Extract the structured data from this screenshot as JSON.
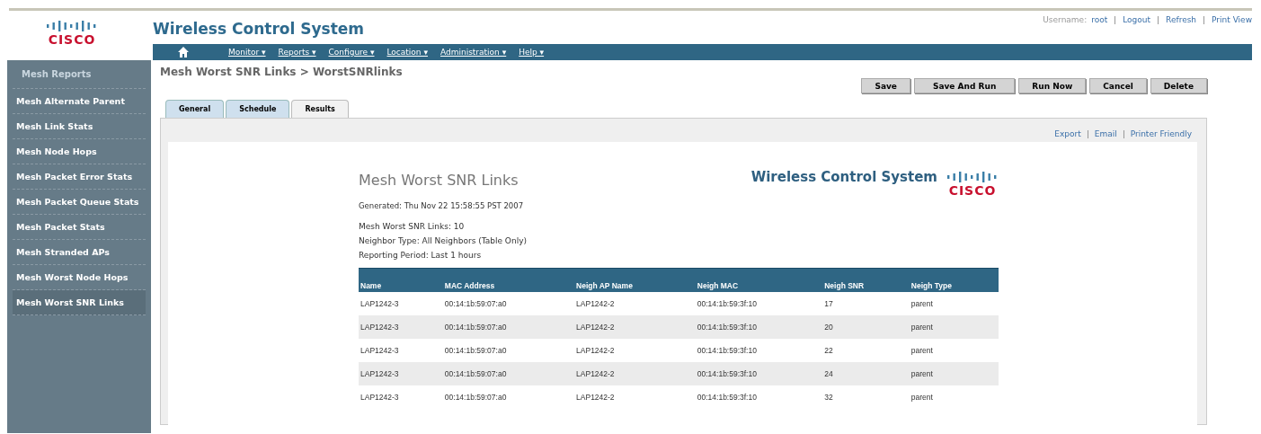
{
  "header": {
    "logo_text": "CISCO",
    "title": "Wireless Control System",
    "user_label": "Username:",
    "user": "root",
    "links": [
      "Logout",
      "Refresh",
      "Print View"
    ]
  },
  "nav": [
    "Monitor ▾",
    "Reports ▾",
    "Configure ▾",
    "Location ▾",
    "Administration ▾",
    "Help ▾"
  ],
  "sidebar": {
    "title": "Mesh Reports",
    "items": [
      {
        "label": "Mesh Alternate Parent",
        "selected": false
      },
      {
        "label": "Mesh Link Stats",
        "selected": false
      },
      {
        "label": "Mesh Node Hops",
        "selected": false
      },
      {
        "label": "Mesh Packet Error Stats",
        "selected": false
      },
      {
        "label": "Mesh Packet Queue Stats",
        "selected": false
      },
      {
        "label": "Mesh Packet Stats",
        "selected": false
      },
      {
        "label": "Mesh Stranded APs",
        "selected": false
      },
      {
        "label": "Mesh Worst Node Hops",
        "selected": false
      },
      {
        "label": "Mesh Worst SNR Links",
        "selected": true
      }
    ]
  },
  "breadcrumb": "Mesh Worst SNR Links > WorstSNRlinks",
  "buttons": [
    "Save",
    "Save And Run",
    "Run Now",
    "Cancel",
    "Delete"
  ],
  "tabs": [
    {
      "label": "General",
      "selected": false
    },
    {
      "label": "Schedule",
      "selected": false
    },
    {
      "label": "Results",
      "selected": true
    }
  ],
  "export_links": [
    "Export",
    "Email",
    "Printer Friendly"
  ],
  "report": {
    "title": "Mesh Worst SNR Links",
    "brand_title": "Wireless Control System",
    "logo_text": "CISCO",
    "generated": "Generated: Thu Nov 22 15:58:55 PST 2007",
    "info": [
      "Mesh Worst SNR Links: 10",
      "Neighbor Type: All Neighbors (Table Only)",
      "Reporting Period: Last 1 hours"
    ],
    "table": {
      "columns": [
        "Name",
        "MAC Address",
        "Neigh AP Name",
        "Neigh MAC",
        "Neigh SNR",
        "Neigh Type"
      ],
      "rows": [
        [
          "LAP1242-3",
          "00:14:1b:59:07:a0",
          "LAP1242-2",
          "00:14:1b:59:3f:10",
          "17",
          "parent"
        ],
        [
          "LAP1242-3",
          "00:14:1b:59:07:a0",
          "LAP1242-2",
          "00:14:1b:59:3f:10",
          "20",
          "parent"
        ],
        [
          "LAP1242-3",
          "00:14:1b:59:07:a0",
          "LAP1242-2",
          "00:14:1b:59:3f:10",
          "22",
          "parent"
        ],
        [
          "LAP1242-3",
          "00:14:1b:59:07:a0",
          "LAP1242-2",
          "00:14:1b:59:3f:10",
          "24",
          "parent"
        ],
        [
          "LAP1242-3",
          "00:14:1b:59:07:a0",
          "LAP1242-2",
          "00:14:1b:59:3f:10",
          "32",
          "parent"
        ]
      ]
    }
  }
}
